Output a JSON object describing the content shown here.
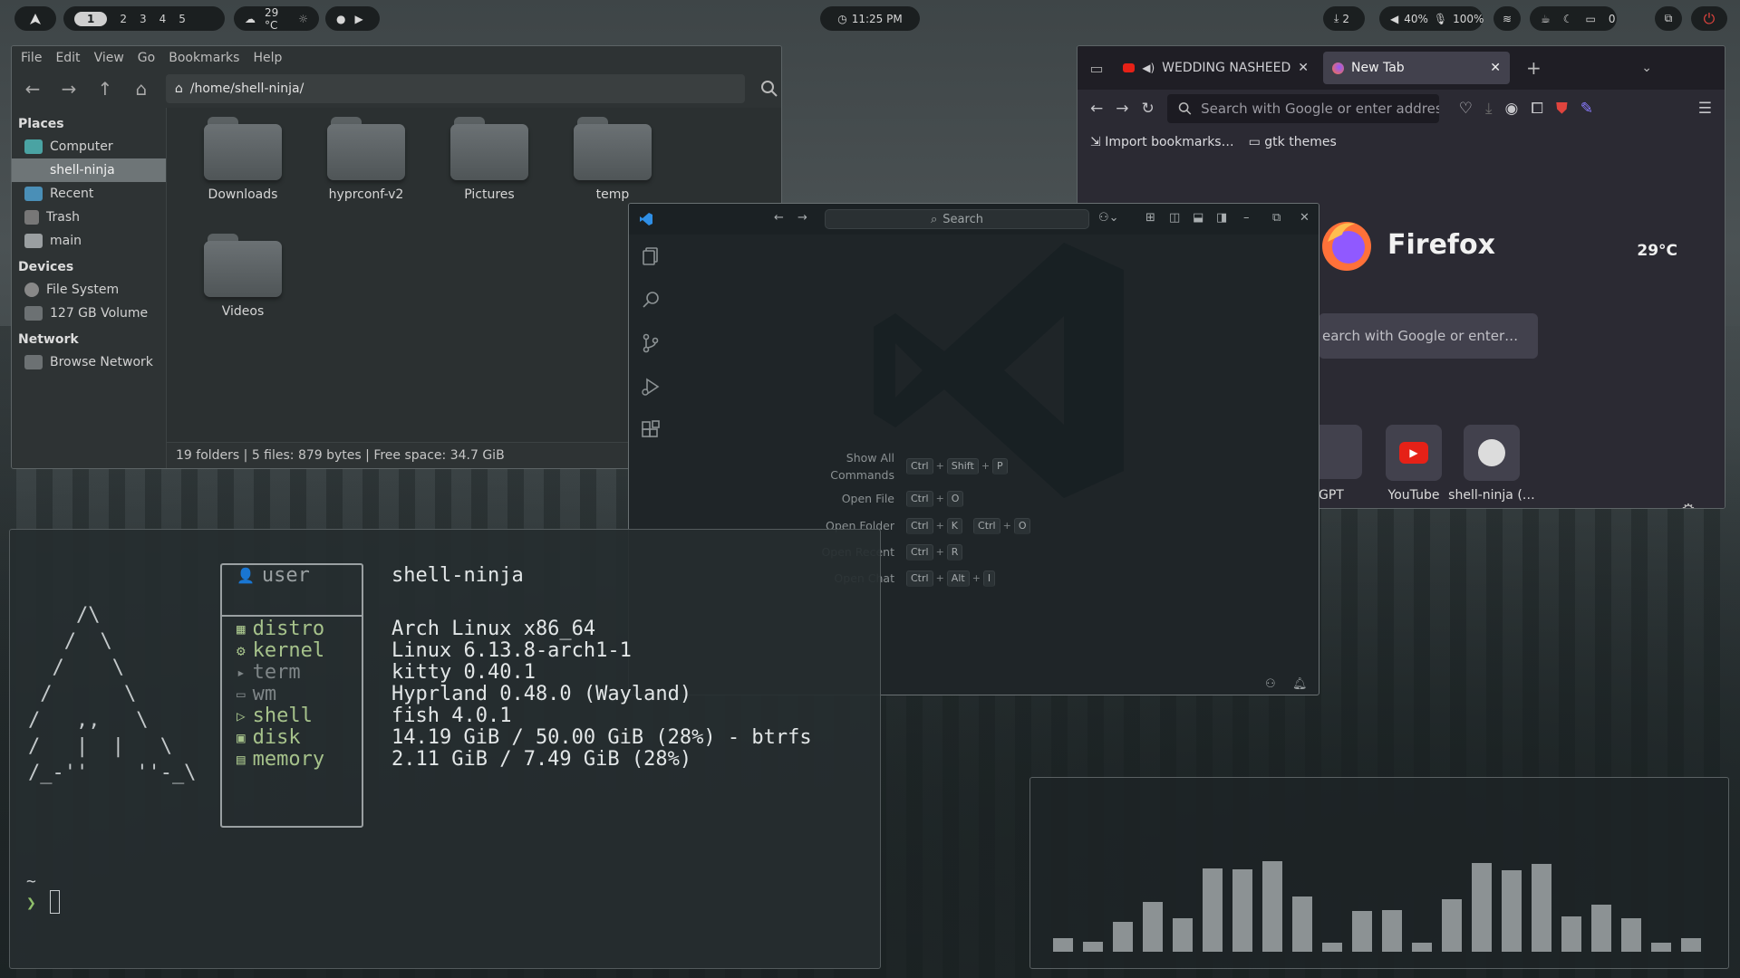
{
  "topbar": {
    "workspaces": [
      "1",
      "2",
      "3",
      "4",
      "5"
    ],
    "weather": "29 °C",
    "clock": "11:25 PM",
    "updates": "2",
    "volume": "40%",
    "mic": "100%",
    "notifications": "0"
  },
  "file_manager": {
    "menu": [
      "File",
      "Edit",
      "View",
      "Go",
      "Bookmarks",
      "Help"
    ],
    "path": "/home/shell-ninja/",
    "sidebar": {
      "places_header": "Places",
      "places": [
        "Computer",
        "shell-ninja",
        "Recent",
        "Trash",
        "main"
      ],
      "devices_header": "Devices",
      "devices": [
        "File System",
        "127 GB Volume"
      ],
      "network_header": "Network",
      "network": [
        "Browse Network"
      ]
    },
    "folders": [
      "Downloads",
      "hyprconf-v2",
      "Pictures",
      "temp",
      "Videos"
    ],
    "status": "19 folders  |  5 files: 879 bytes  |  Free space: 34.7 GiB"
  },
  "firefox": {
    "tabs": [
      "WEDDING NASHEED",
      "New Tab"
    ],
    "url_placeholder": "Search with Google or enter address",
    "bookmarks": [
      "Import bookmarks…",
      "gtk themes"
    ],
    "brand": "Firefox",
    "weather": "29°C",
    "search_placeholder": "earch with Google or enter…",
    "shortcuts": [
      "GPT",
      "YouTube",
      "shell-ninja (…"
    ]
  },
  "vscode": {
    "search": "Search",
    "shortcuts": [
      {
        "label": "Show All Commands",
        "keys": [
          [
            "Ctrl",
            "Shift",
            "P"
          ]
        ]
      },
      {
        "label": "Open File",
        "keys": [
          [
            "Ctrl",
            "O"
          ]
        ]
      },
      {
        "label": "Open Folder",
        "keys": [
          [
            "Ctrl",
            "K"
          ],
          [
            "Ctrl",
            "O"
          ]
        ]
      },
      {
        "label": "Open Recent",
        "keys": [
          [
            "Ctrl",
            "R"
          ]
        ]
      },
      {
        "label": "Open Chat",
        "keys": [
          [
            "Ctrl",
            "Alt",
            "I"
          ]
        ]
      }
    ]
  },
  "terminal": {
    "ascii_art": "    /\\\n   /  \\\n  /    \\\n /      \\\n/   ,,   \\\n/   |  |   \\\n/_-''    ''-_\\",
    "info": [
      {
        "key": "user",
        "value": "shell-ninja"
      },
      {
        "key": "distro",
        "value": "Arch Linux x86_64"
      },
      {
        "key": "kernel",
        "value": "Linux 6.13.8-arch1-1"
      },
      {
        "key": "term",
        "value": "kitty 0.40.1"
      },
      {
        "key": "wm",
        "value": "Hyprland 0.48.0 (Wayland)"
      },
      {
        "key": "shell",
        "value": "fish 4.0.1"
      },
      {
        "key": "disk",
        "value": "14.19 GiB / 50.00 GiB (28%) - btrfs"
      },
      {
        "key": "memory",
        "value": "2.11 GiB / 7.49 GiB (28%)"
      }
    ],
    "cwd": "~",
    "prompt": "❯"
  },
  "visualizer": {
    "levels": [
      0.15,
      0.11,
      0.33,
      0.55,
      0.37,
      0.92,
      0.91,
      1.0,
      0.61,
      0.1,
      0.45,
      0.46,
      0.1,
      0.58,
      0.98,
      0.9,
      0.97,
      0.39,
      0.52,
      0.37,
      0.1,
      0.15
    ]
  },
  "colors": {
    "accent_red": "#e0443e",
    "firefox_orange": "#ff7139",
    "vscode_blue": "#2f8fe6",
    "youtube_red": "#e62117"
  }
}
